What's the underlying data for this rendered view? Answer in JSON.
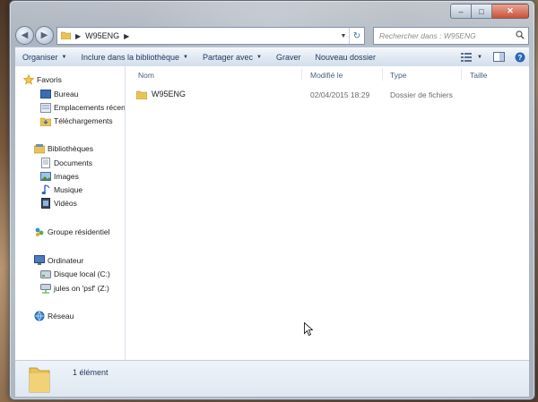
{
  "address": {
    "path": [
      "W95ENG"
    ],
    "search_placeholder": "Rechercher dans : W95ENG"
  },
  "toolbar": {
    "organize": "Organiser",
    "include_library": "Inclure dans la bibliothèque",
    "share": "Partager avec",
    "burn": "Graver",
    "new_folder": "Nouveau dossier"
  },
  "nav": {
    "favorites": "Favoris",
    "desktop": "Bureau",
    "recent": "Emplacements récents",
    "downloads": "Téléchargements",
    "libraries": "Bibliothèques",
    "documents": "Documents",
    "images": "Images",
    "music": "Musique",
    "videos": "Vidéos",
    "homegroup": "Groupe résidentiel",
    "computer": "Ordinateur",
    "local_disk": "Disque local (C:)",
    "network_drive": "jules on 'psf' (Z:)",
    "network": "Réseau"
  },
  "columns": {
    "name": "Nom",
    "modified": "Modifié le",
    "type": "Type",
    "size": "Taille"
  },
  "files": [
    {
      "name": "W95ENG",
      "modified": "02/04/2015 18:29",
      "type": "Dossier de fichiers",
      "size": ""
    }
  ],
  "status": {
    "count": "1 élément"
  }
}
